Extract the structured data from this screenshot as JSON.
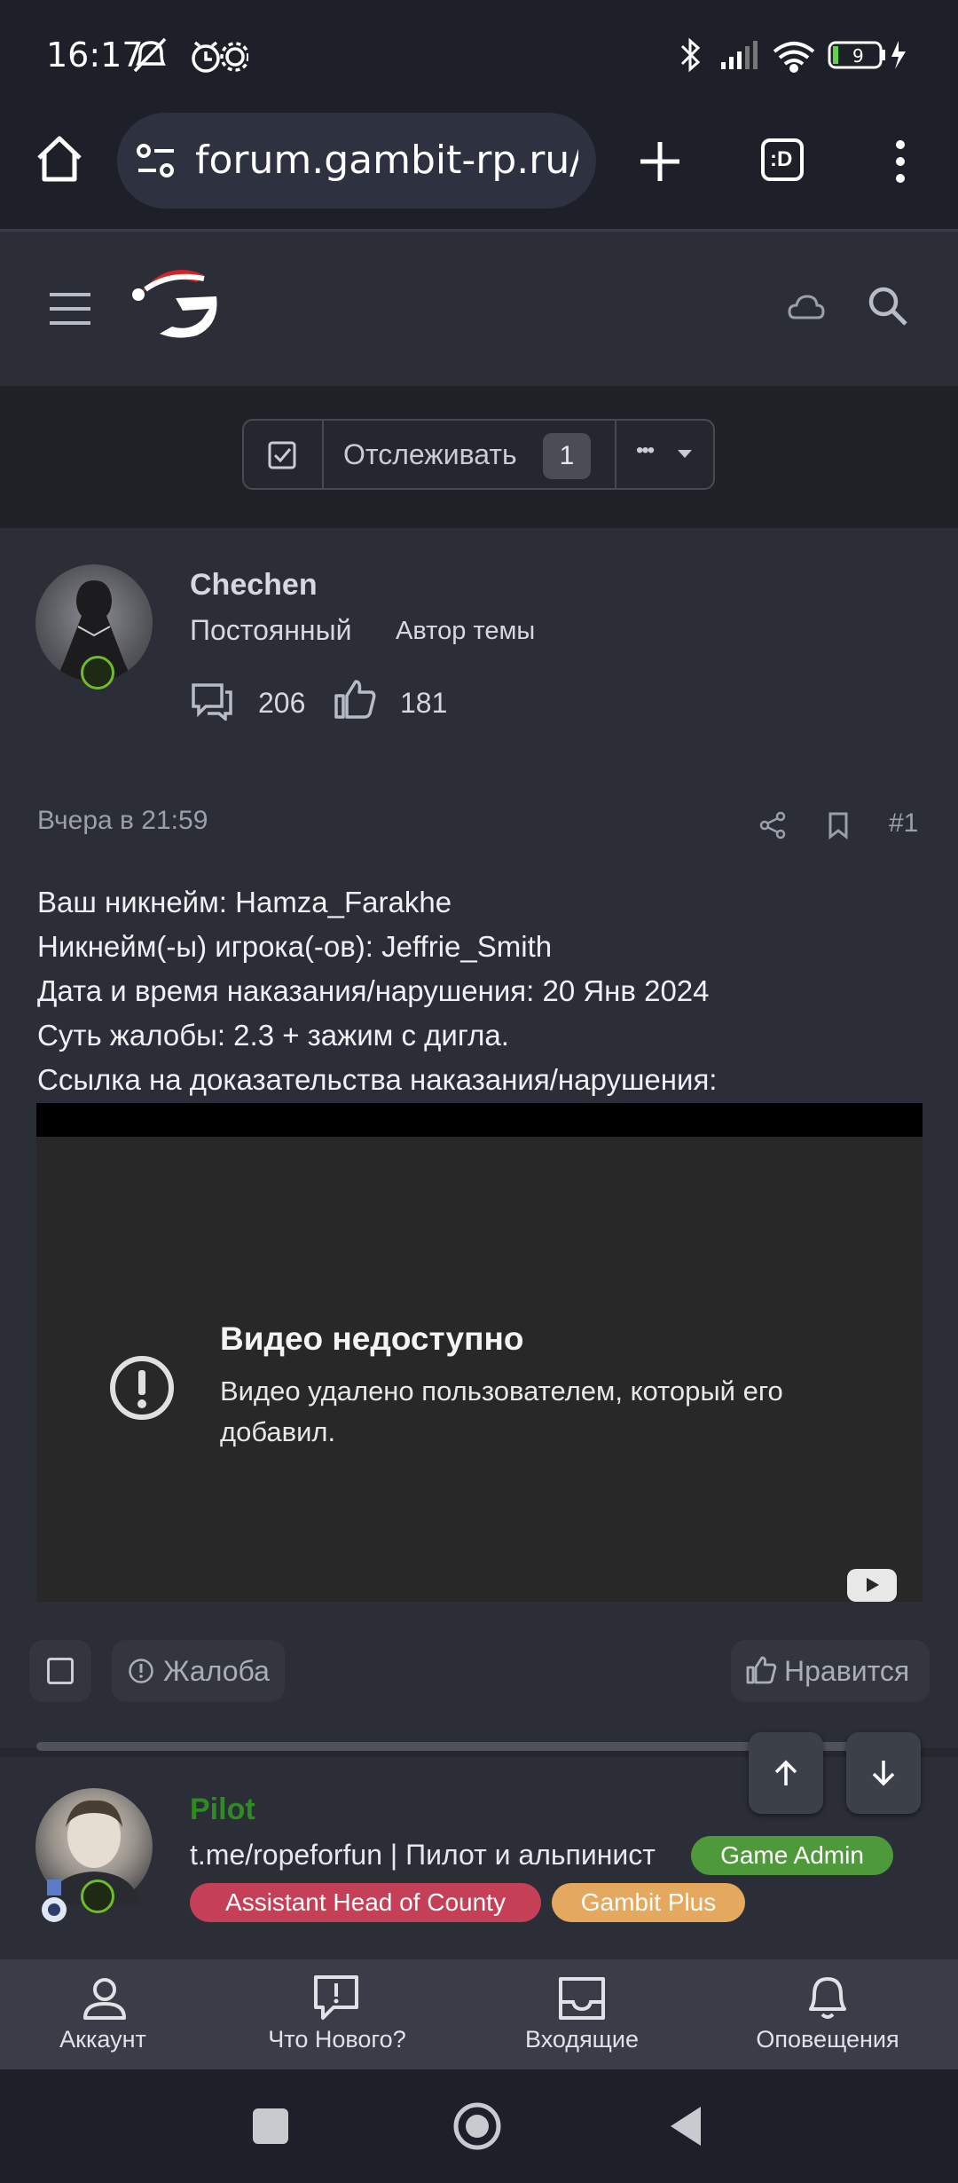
{
  "status_bar": {
    "time": "16:17",
    "battery_level": "9"
  },
  "browser": {
    "url": "forum.gambit-rp.ru/threads",
    "tab_count_label": ":D"
  },
  "watch_bar": {
    "watch_label": "Отслеживать",
    "watch_count": "1",
    "more_label": "•••"
  },
  "post": {
    "author": {
      "name": "Chechen",
      "title": "Постоянный",
      "starter_label": "Автор темы",
      "messages": "206",
      "reactions": "181"
    },
    "date": "Вчера в 21:59",
    "number": "#1",
    "lines": [
      "Ваш никнейм: Hamza_Farakhe",
      "Никнейм(-ы) игрока(-ов): Jeffrie_Smith",
      "Дата и время наказания/нарушения: 20 Янв 2024",
      "Суть жалобы: 2.3 + зажим с дигла.",
      "Ссылка на доказательства наказания/нарушения:"
    ],
    "video": {
      "title": "Видео недоступно",
      "message": "Видео удалено пользователем, который его добавил."
    },
    "actions": {
      "report_label": "Жалоба",
      "like_label": "Нравится"
    }
  },
  "post2": {
    "author": {
      "name": "Pilot",
      "title": "t.me/ropeforfun | Пилот и альпинист",
      "badges": [
        "Game Admin",
        "Assistant Head of County",
        "Gambit Plus"
      ]
    }
  },
  "bottom_nav": {
    "items": [
      {
        "label": "Аккаунт",
        "icon": "account-icon"
      },
      {
        "label": "Что Нового?",
        "icon": "whats-new-icon"
      },
      {
        "label": "Входящие",
        "icon": "inbox-icon"
      },
      {
        "label": "Оповещения",
        "icon": "bell-icon"
      }
    ]
  },
  "colors": {
    "game_admin": "#4e9a3a",
    "assistant_head": "#c53f57",
    "gambit_plus": "#e4a85e",
    "pilot_name": "#2e8b22",
    "online": "#6fbb2a"
  }
}
